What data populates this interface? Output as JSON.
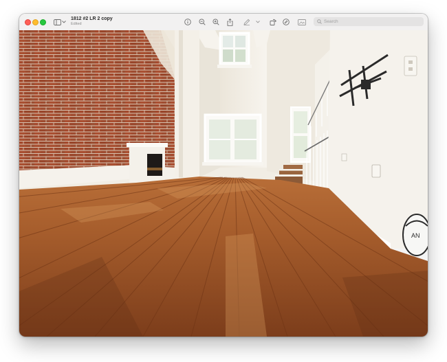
{
  "window": {
    "title": "1812 #2 LR 2 copy",
    "subtitle": "Edited"
  },
  "toolbar": {
    "icons": [
      "sidebar-icon",
      "chevron-down-icon",
      "info-icon",
      "zoom-out-icon",
      "zoom-in-icon",
      "share-icon",
      "markup-icon",
      "chevron-down-icon",
      "rotate-icon",
      "markup-circle-icon",
      "edit-photo-icon"
    ]
  },
  "search": {
    "placeholder": "Search"
  },
  "colors": {
    "brick": "#a0482c",
    "floor": "#a35a2a",
    "wall": "#f2efe8"
  }
}
